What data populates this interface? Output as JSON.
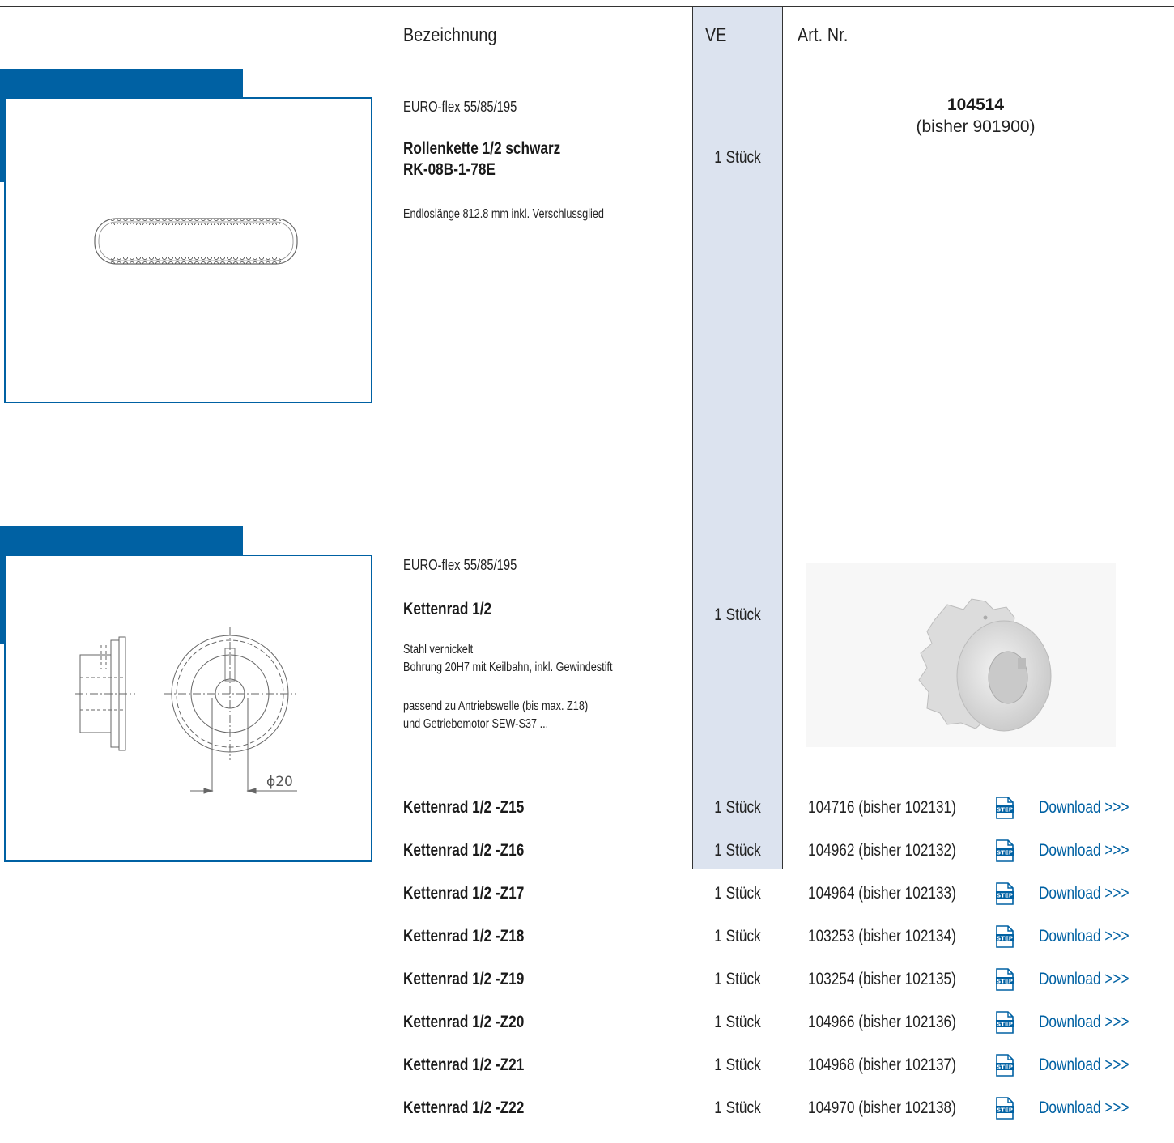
{
  "header": {
    "col_bezeichnung": "Bezeichnung",
    "col_ve": "VE",
    "col_artnr": "Art. Nr."
  },
  "product1": {
    "series": "EURO-flex 55/85/195",
    "name_line1": "Rollenkette 1/2 schwarz",
    "name_line2": "RK-08B-1-78E",
    "description": "Endloslänge 812.8 mm inkl. Verschlussglied",
    "ve": "1 Stück",
    "art_nr": "104514",
    "art_nr_old": "(bisher 901900)"
  },
  "product2": {
    "series": "EURO-flex 55/85/195",
    "name": "Kettenrad 1/2",
    "desc_line1": "Stahl vernickelt",
    "desc_line2": "Bohrung 20H7 mit Keilbahn, inkl. Gewindestift",
    "desc_line3": "passend zu Antriebswelle (bis max. Z18)",
    "desc_line4": "und Getriebemotor SEW-S37 ...",
    "ve": "1 Stück",
    "drawing_dimension": "ϕ20",
    "variants": [
      {
        "name": "Kettenrad 1/2 -Z15",
        "ve": "1 Stück",
        "art": "104716 (bisher 102131)",
        "icon": "step-file-icon",
        "link": "Download >>>"
      },
      {
        "name": "Kettenrad 1/2 -Z16",
        "ve": "1 Stück",
        "art": "104962 (bisher 102132)",
        "icon": "step-file-icon",
        "link": "Download >>>"
      },
      {
        "name": "Kettenrad 1/2 -Z17",
        "ve": "1 Stück",
        "art": "104964 (bisher 102133)",
        "icon": "step-file-icon",
        "link": "Download >>>"
      },
      {
        "name": "Kettenrad 1/2 -Z18",
        "ve": "1 Stück",
        "art": "103253 (bisher 102134)",
        "icon": "step-file-icon",
        "link": "Download >>>"
      },
      {
        "name": "Kettenrad 1/2 -Z19",
        "ve": "1 Stück",
        "art": "103254 (bisher 102135)",
        "icon": "step-file-icon",
        "link": "Download >>>"
      },
      {
        "name": "Kettenrad 1/2 -Z20",
        "ve": "1 Stück",
        "art": "104966 (bisher 102136)",
        "icon": "step-file-icon",
        "link": "Download >>>"
      },
      {
        "name": "Kettenrad 1/2 -Z21",
        "ve": "1 Stück",
        "art": "104968 (bisher 102137)",
        "icon": "step-file-icon",
        "link": "Download >>>"
      },
      {
        "name": "Kettenrad 1/2 -Z22",
        "ve": "1 Stück",
        "art": "104970 (bisher 102138)",
        "icon": "step-file-icon",
        "link": "Download >>>"
      }
    ]
  },
  "step_icon_text": "STEP",
  "colors": {
    "brand_blue": "#0061a3",
    "ve_band": "#dce3ef"
  }
}
